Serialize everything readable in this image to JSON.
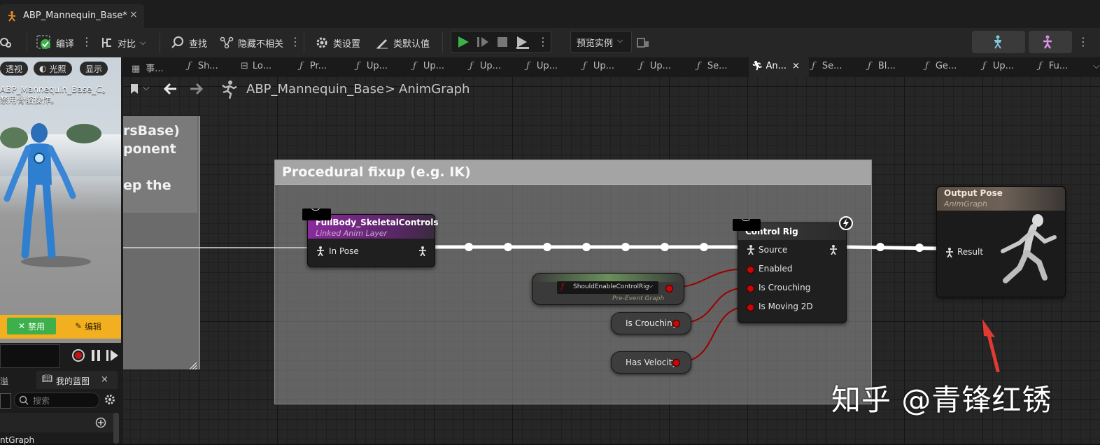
{
  "window": {
    "tab_title": "ABP_Mannequin_Base*",
    "close_glyph": "×"
  },
  "toolbar": {
    "compile_label": "编译",
    "diff_label": "对比",
    "find_label": "查找",
    "hide_unrelated_label": "隐藏不相关",
    "class_settings_label": "类设置",
    "class_defaults_label": "类默认值",
    "preview_instance_label": "预览实例"
  },
  "graph_tabs": [
    {
      "icon": "",
      "label": "事..."
    },
    {
      "icon": "ƒ",
      "label": "Sh..."
    },
    {
      "icon": "",
      "label": "Lo..."
    },
    {
      "icon": "ƒ",
      "label": "Pr..."
    },
    {
      "icon": "ƒ",
      "label": "Up..."
    },
    {
      "icon": "ƒ",
      "label": "Up..."
    },
    {
      "icon": "ƒ",
      "label": "Up..."
    },
    {
      "icon": "ƒ",
      "label": "Up..."
    },
    {
      "icon": "ƒ",
      "label": "Up..."
    },
    {
      "icon": "ƒ",
      "label": "Up..."
    },
    {
      "icon": "ƒ",
      "label": "Se..."
    },
    {
      "icon": "",
      "label": "An..."
    },
    {
      "icon": "ƒ",
      "label": "Se..."
    },
    {
      "icon": "ƒ",
      "label": "Bl..."
    },
    {
      "icon": "ƒ",
      "label": "Ge..."
    },
    {
      "icon": "ƒ",
      "label": "Up..."
    },
    {
      "icon": "ƒ",
      "label": "Fu..."
    }
  ],
  "breadcrumb": {
    "asset": "ABP_Mannequin_Base",
    "separator": ">",
    "graph": "AnimGraph"
  },
  "viewport": {
    "btn_perspective": "透视",
    "btn_lit": "光照",
    "btn_show": "显示",
    "note_line1": "ABP_Mannequin_Base_C。",
    "note_line2": "禁用骨骼操作。",
    "disable_label": "禁用",
    "edit_label": "编辑"
  },
  "my_blueprint": {
    "tab_label": "我的蓝图",
    "search_placeholder": "搜索",
    "tree_item": "ntGraph"
  },
  "left_comment": {
    "line1": "rsBase)",
    "line2": "ponent",
    "line3": "ep the"
  },
  "comment_box": {
    "title": "Procedural fixup (e.g. IK)"
  },
  "nodes": {
    "fullbody": {
      "title": "FullBody_SkeletalControls",
      "subtitle": "Linked Anim Layer",
      "pin_in_pose": "In Pose"
    },
    "control_rig": {
      "title": "Control Rig",
      "pin_source": "Source",
      "pin_enabled": "Enabled",
      "pin_is_crouching": "Is Crouching",
      "pin_is_moving_2d": "Is Moving 2D"
    },
    "should_enable": {
      "title": "ShouldEnableControlRig",
      "subtitle": "Pre-Event Graph"
    },
    "var_is_crouching": {
      "label": "Is Crouching"
    },
    "var_has_velocity": {
      "label": "Has Velocity"
    },
    "output_pose": {
      "title": "Output Pose",
      "subtitle": "AnimGraph",
      "pin_result": "Result"
    }
  },
  "watermark": "知乎 @青锋红锈",
  "colors": {
    "exec_wire": "#ffffff",
    "bool_pin": "#c80606",
    "linked_layer_header": "#7a2a8a",
    "play_green": "#3bb24b",
    "annotation_arrow": "#e03a32"
  }
}
